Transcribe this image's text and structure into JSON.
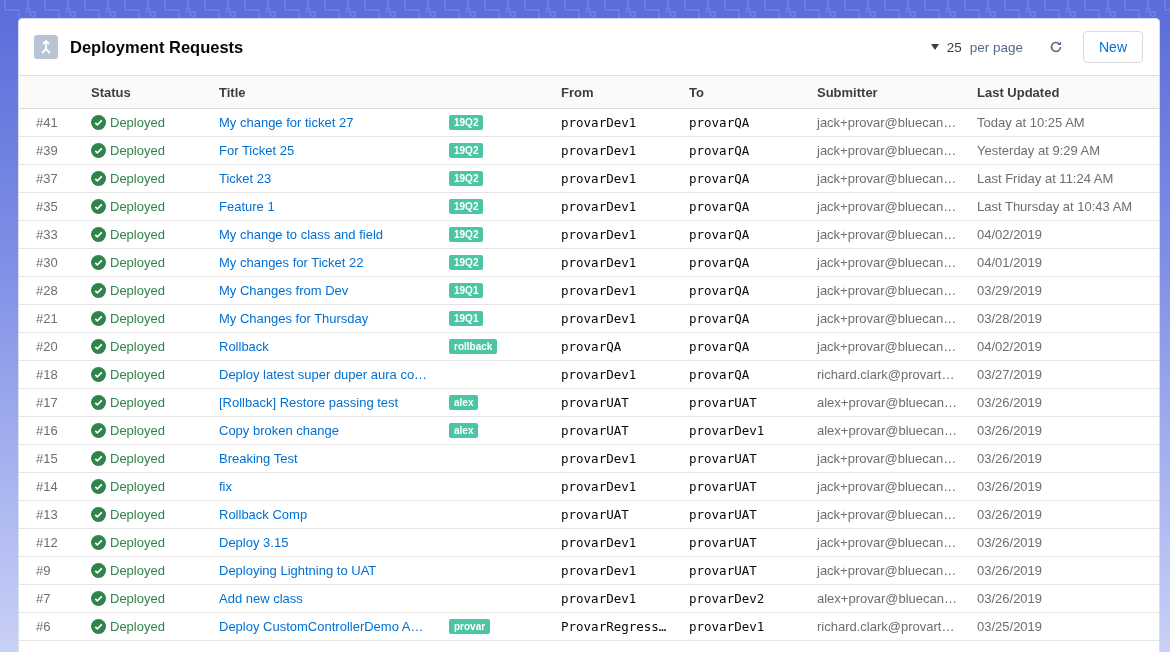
{
  "header": {
    "title": "Deployment Requests",
    "page_size": "25",
    "page_size_label": "per page",
    "new_button": "New"
  },
  "columns": [
    "Status",
    "Title",
    "From",
    "To",
    "Submitter",
    "Last Updated"
  ],
  "rows": [
    {
      "number": "#41",
      "status": {
        "kind": "deployed",
        "label": "Deployed"
      },
      "title": "My change for ticket 27",
      "tag": "19Q2",
      "from": "provarDev1",
      "to": "provarQA",
      "submitter": "jack+provar@bluecan…",
      "updated": "Today at 10:25 AM"
    },
    {
      "number": "#39",
      "status": {
        "kind": "deployed",
        "label": "Deployed"
      },
      "title": "For Ticket 25",
      "tag": "19Q2",
      "from": "provarDev1",
      "to": "provarQA",
      "submitter": "jack+provar@bluecan…",
      "updated": "Yesterday at 9:29 AM"
    },
    {
      "number": "#37",
      "status": {
        "kind": "deployed",
        "label": "Deployed"
      },
      "title": "Ticket 23",
      "tag": "19Q2",
      "from": "provarDev1",
      "to": "provarQA",
      "submitter": "jack+provar@bluecan…",
      "updated": "Last Friday at 11:24 AM"
    },
    {
      "number": "#35",
      "status": {
        "kind": "deployed",
        "label": "Deployed"
      },
      "title": "Feature 1",
      "tag": "19Q2",
      "from": "provarDev1",
      "to": "provarQA",
      "submitter": "jack+provar@bluecan…",
      "updated": "Last Thursday at 10:43 AM"
    },
    {
      "number": "#33",
      "status": {
        "kind": "deployed",
        "label": "Deployed"
      },
      "title": "My change to class and field",
      "tag": "19Q2",
      "from": "provarDev1",
      "to": "provarQA",
      "submitter": "jack+provar@bluecan…",
      "updated": "04/02/2019"
    },
    {
      "number": "#30",
      "status": {
        "kind": "deployed",
        "label": "Deployed"
      },
      "title": "My changes for Ticket 22",
      "tag": "19Q2",
      "from": "provarDev1",
      "to": "provarQA",
      "submitter": "jack+provar@bluecan…",
      "updated": "04/01/2019"
    },
    {
      "number": "#28",
      "status": {
        "kind": "deployed",
        "label": "Deployed"
      },
      "title": "My Changes from Dev",
      "tag": "19Q1",
      "from": "provarDev1",
      "to": "provarQA",
      "submitter": "jack+provar@bluecan…",
      "updated": "03/29/2019"
    },
    {
      "number": "#21",
      "status": {
        "kind": "deployed",
        "label": "Deployed"
      },
      "title": "My Changes for Thursday",
      "tag": "19Q1",
      "from": "provarDev1",
      "to": "provarQA",
      "submitter": "jack+provar@bluecan…",
      "updated": "03/28/2019"
    },
    {
      "number": "#20",
      "status": {
        "kind": "deployed",
        "label": "Deployed"
      },
      "title": "Rollback",
      "tag": "rollback",
      "from": "provarQA",
      "to": "provarQA",
      "submitter": "jack+provar@bluecan…",
      "updated": "04/02/2019"
    },
    {
      "number": "#18",
      "status": {
        "kind": "deployed",
        "label": "Deployed"
      },
      "title": "Deploy latest super duper aura co…",
      "from": "provarDev1",
      "to": "provarQA",
      "submitter": "richard.clark@provart…",
      "updated": "03/27/2019"
    },
    {
      "number": "#17",
      "status": {
        "kind": "deployed",
        "label": "Deployed"
      },
      "title": "[Rollback] Restore passing test",
      "tag": "alex",
      "from": "provarUAT",
      "to": "provarUAT",
      "submitter": "alex+provar@bluecan…",
      "updated": "03/26/2019"
    },
    {
      "number": "#16",
      "status": {
        "kind": "deployed",
        "label": "Deployed"
      },
      "title": "Copy broken change",
      "tag": "alex",
      "from": "provarUAT",
      "to": "provarDev1",
      "submitter": "alex+provar@bluecan…",
      "updated": "03/26/2019"
    },
    {
      "number": "#15",
      "status": {
        "kind": "deployed",
        "label": "Deployed"
      },
      "title": "Breaking Test",
      "from": "provarDev1",
      "to": "provarUAT",
      "submitter": "jack+provar@bluecan…",
      "updated": "03/26/2019"
    },
    {
      "number": "#14",
      "status": {
        "kind": "deployed",
        "label": "Deployed"
      },
      "title": "fix",
      "from": "provarDev1",
      "to": "provarUAT",
      "submitter": "jack+provar@bluecan…",
      "updated": "03/26/2019"
    },
    {
      "number": "#13",
      "status": {
        "kind": "deployed",
        "label": "Deployed"
      },
      "title": "Rollback Comp",
      "from": "provarUAT",
      "to": "provarUAT",
      "submitter": "jack+provar@bluecan…",
      "updated": "03/26/2019"
    },
    {
      "number": "#12",
      "status": {
        "kind": "deployed",
        "label": "Deployed"
      },
      "title": "Deploy 3.15",
      "from": "provarDev1",
      "to": "provarUAT",
      "submitter": "jack+provar@bluecan…",
      "updated": "03/26/2019"
    },
    {
      "number": "#9",
      "status": {
        "kind": "deployed",
        "label": "Deployed"
      },
      "title": "Deploying Lightning to UAT",
      "from": "provarDev1",
      "to": "provarUAT",
      "submitter": "jack+provar@bluecan…",
      "updated": "03/26/2019"
    },
    {
      "number": "#7",
      "status": {
        "kind": "deployed",
        "label": "Deployed"
      },
      "title": "Add new class",
      "from": "provarDev1",
      "to": "provarDev2",
      "submitter": "alex+provar@bluecan…",
      "updated": "03/26/2019"
    },
    {
      "number": "#6",
      "status": {
        "kind": "deployed",
        "label": "Deployed"
      },
      "title": "Deploy CustomControllerDemo A…",
      "tag": "provar",
      "from": "ProvarRegress…",
      "to": "provarDev1",
      "submitter": "richard.clark@provart…",
      "updated": "03/25/2019"
    }
  ]
}
